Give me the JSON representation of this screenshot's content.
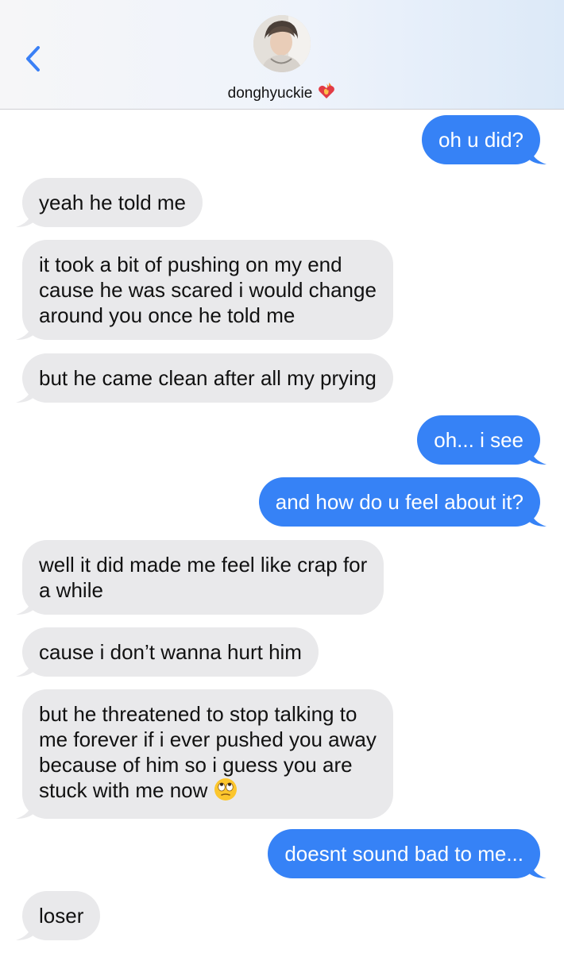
{
  "header": {
    "contact_name": "donghyuckie",
    "name_emoji": "heart-on-fire",
    "back_icon": "chevron-left-icon",
    "accent_color": "#3a80f6"
  },
  "conversation": {
    "colors": {
      "incoming": "#e9e9eb",
      "outgoing": "#3682f6"
    },
    "messages": [
      {
        "from": "me",
        "lines": [
          "oh u did?"
        ]
      },
      {
        "from": "contact",
        "lines": [
          "yeah he told me"
        ]
      },
      {
        "from": "contact",
        "lines": [
          "it took a bit of pushing on my end",
          "cause he was scared i would change",
          "around you once he told me"
        ]
      },
      {
        "from": "contact",
        "lines": [
          "but he came clean after all my prying"
        ]
      },
      {
        "from": "me",
        "lines": [
          "oh... i see"
        ]
      },
      {
        "from": "me",
        "lines": [
          "and how do u feel about it?"
        ]
      },
      {
        "from": "contact",
        "lines": [
          "well it did made me feel like crap for",
          "a while"
        ]
      },
      {
        "from": "contact",
        "lines": [
          "cause i don’t wanna hurt him"
        ]
      },
      {
        "from": "contact",
        "lines": [
          "but he threatened to stop talking to",
          "me forever if i ever pushed you away",
          "because of him so i guess you are",
          "stuck with me now"
        ],
        "emoji": "eye-roll-emoji"
      },
      {
        "from": "me",
        "lines": [
          "doesnt sound bad to me..."
        ]
      },
      {
        "from": "contact",
        "lines": [
          "loser"
        ]
      }
    ]
  }
}
